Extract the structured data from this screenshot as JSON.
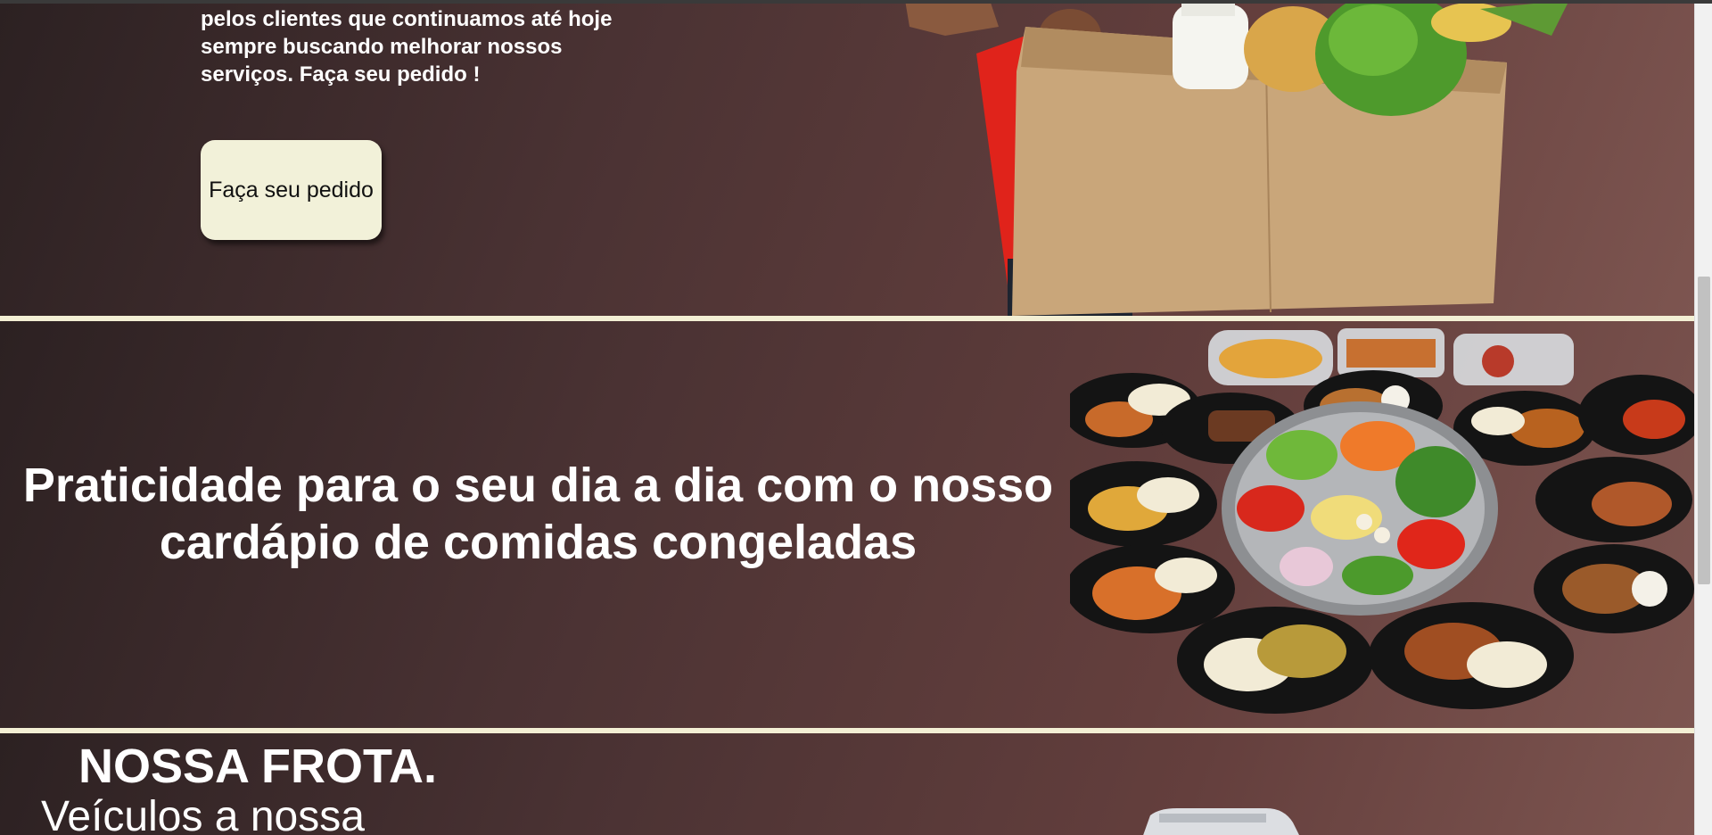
{
  "intro": {
    "lines": [
      "pelos clientes que continuamos até hoje",
      "sempre buscando melhorar nossos",
      "serviços. Faça seu pedido !"
    ],
    "button_label": "Faça seu pedido"
  },
  "practicality": {
    "heading_lines": [
      "Praticidade para o seu dia a dia com o nosso",
      "cardápio de comidas congeladas"
    ]
  },
  "fleet": {
    "title": "NOSSA FROTA.",
    "subtitle": "Veículos a nossa"
  },
  "colors": {
    "divider": "#f3efd4",
    "button_bg": "#f2f1d9",
    "section_dark": "#2c2122",
    "section_light": "#7d5550"
  }
}
